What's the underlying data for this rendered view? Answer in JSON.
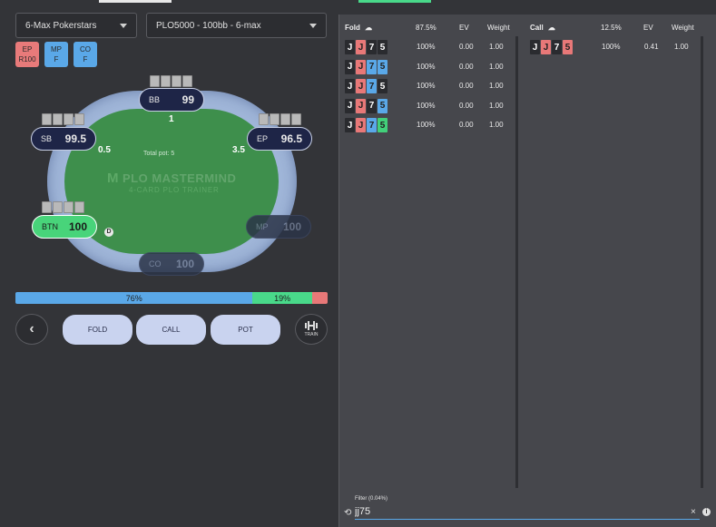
{
  "selectors": {
    "site": "6-Max Pokerstars",
    "game": "PLO5000 - 100bb - 6-max"
  },
  "action_chips": [
    {
      "pos": "EP",
      "action": "R100",
      "color": "#e87a7a"
    },
    {
      "pos": "MP",
      "action": "F",
      "color": "#5aa8e8"
    },
    {
      "pos": "CO",
      "action": "F",
      "color": "#5aa8e8"
    }
  ],
  "table": {
    "logo": "PLO MASTERMIND",
    "logo_sub": "4-CARD PLO TRAINER",
    "total_pot": "Total pot: 5",
    "dealer": "D",
    "seats": {
      "bb": {
        "name": "BB",
        "stack": "99",
        "bet": "1"
      },
      "sb": {
        "name": "SB",
        "stack": "99.5",
        "bet": "0.5"
      },
      "ep": {
        "name": "EP",
        "stack": "96.5",
        "bet": "3.5"
      },
      "btn": {
        "name": "BTN",
        "stack": "100"
      },
      "mp": {
        "name": "MP",
        "stack": "100"
      },
      "co": {
        "name": "CO",
        "stack": "100"
      }
    }
  },
  "frequency": {
    "fold": {
      "label": "76%",
      "value": 76,
      "color": "#5aa8e8"
    },
    "call": {
      "label": "19%",
      "value": 19,
      "color": "#49d98a"
    },
    "raise": {
      "value": 5,
      "color": "#e87878"
    }
  },
  "actions": {
    "back": "‹",
    "fold": "FOLD",
    "call": "CALL",
    "pot": "POT",
    "train": "TRAIN"
  },
  "fold_table": {
    "title": "Fold",
    "freq": "87.5%",
    "ev_header": "EV",
    "weight_header": "Weight",
    "rows": [
      {
        "cards": [
          "J",
          "J",
          "7",
          "5"
        ],
        "colors": [
          "k",
          "r",
          "k",
          "k"
        ],
        "pct": "100%",
        "ev": "0.00",
        "weight": "1.00"
      },
      {
        "cards": [
          "J",
          "J",
          "7",
          "5"
        ],
        "colors": [
          "k",
          "r",
          "b",
          "b"
        ],
        "pct": "100%",
        "ev": "0.00",
        "weight": "1.00"
      },
      {
        "cards": [
          "J",
          "J",
          "7",
          "5"
        ],
        "colors": [
          "k",
          "r",
          "b",
          "k"
        ],
        "pct": "100%",
        "ev": "0.00",
        "weight": "1.00"
      },
      {
        "cards": [
          "J",
          "J",
          "7",
          "5"
        ],
        "colors": [
          "k",
          "r",
          "k",
          "b"
        ],
        "pct": "100%",
        "ev": "0.00",
        "weight": "1.00"
      },
      {
        "cards": [
          "J",
          "J",
          "7",
          "5"
        ],
        "colors": [
          "k",
          "r",
          "b",
          "g"
        ],
        "pct": "100%",
        "ev": "0.00",
        "weight": "1.00"
      }
    ]
  },
  "call_table": {
    "title": "Call",
    "freq": "12.5%",
    "ev_header": "EV",
    "weight_header": "Weight",
    "rows": [
      {
        "cards": [
          "J",
          "J",
          "7",
          "5"
        ],
        "colors": [
          "k",
          "r",
          "k",
          "r"
        ],
        "pct": "100%",
        "ev": "0.41",
        "weight": "1.00"
      }
    ]
  },
  "filter": {
    "label": "Filter (0.04%)",
    "value": "jj75",
    "clear": "×",
    "info": "i"
  }
}
